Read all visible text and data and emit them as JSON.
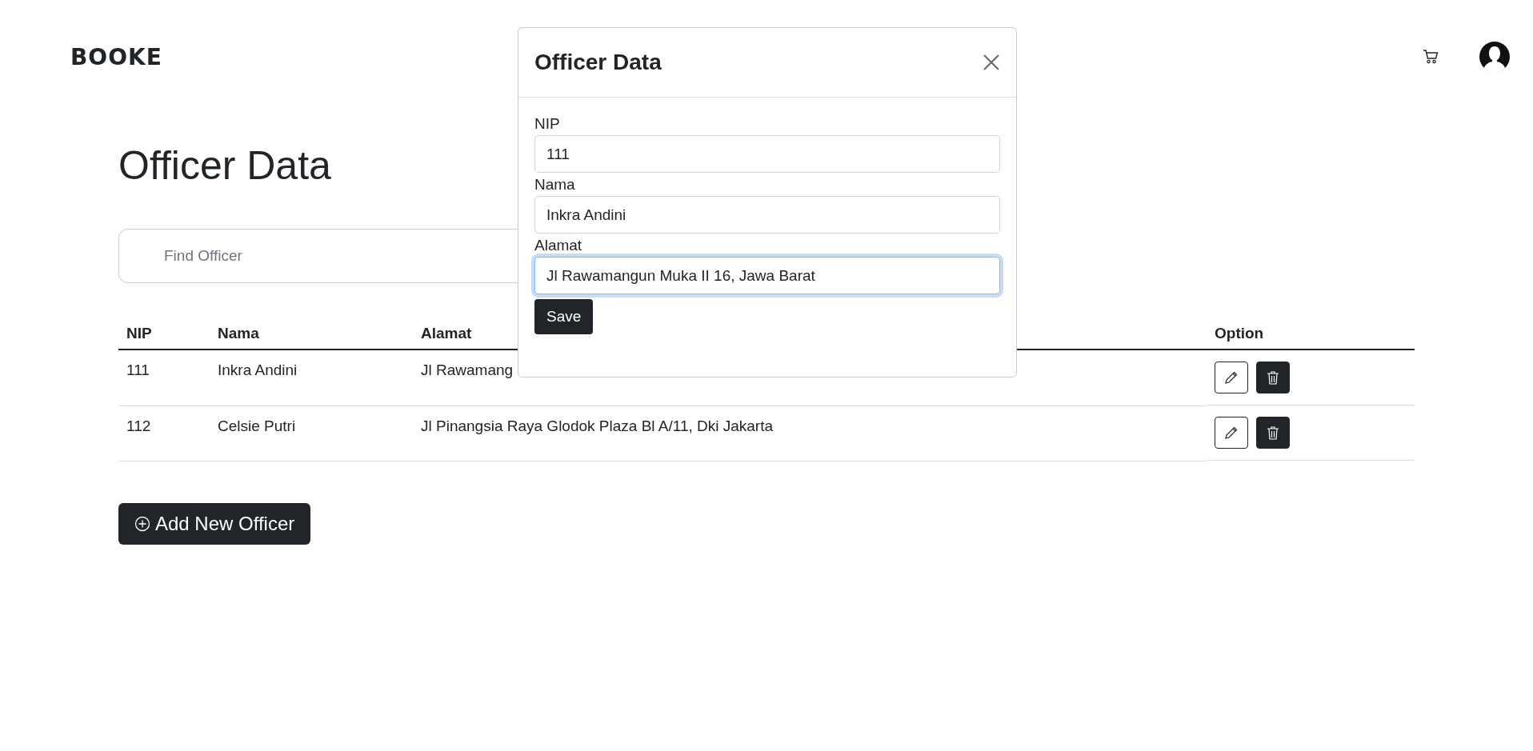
{
  "header": {
    "logo": "BOOKE"
  },
  "page": {
    "title": "Officer Data",
    "search": {
      "placeholder": "Find Officer"
    }
  },
  "table": {
    "columns": [
      "NIP",
      "Nama",
      "Alamat",
      "Option"
    ],
    "rows": [
      {
        "nip": "111",
        "nama": "Inkra Andini",
        "alamat": "Jl Rawamang"
      },
      {
        "nip": "112",
        "nama": "Celsie Putri",
        "alamat": "Jl Pinangsia Raya Glodok Plaza Bl A/11, Dki Jakarta"
      }
    ]
  },
  "add_button": {
    "label": "Add New Officer"
  },
  "modal": {
    "title": "Officer Data",
    "fields": [
      {
        "label": "NIP",
        "value": "111",
        "focused": false
      },
      {
        "label": "Nama",
        "value": "Inkra Andini",
        "focused": false
      },
      {
        "label": "Alamat",
        "value": "Jl Rawamangun Muka II 16, Jawa Barat",
        "focused": true
      }
    ],
    "save_button": "Save"
  }
}
